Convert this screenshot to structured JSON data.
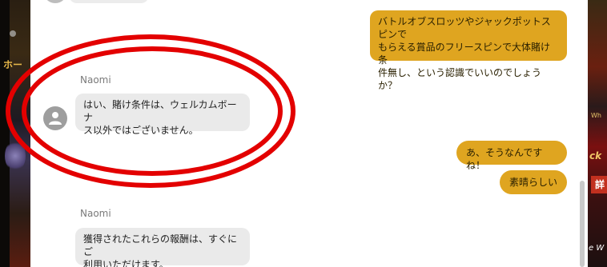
{
  "chat": {
    "messages": [
      {
        "direction": "outgoing",
        "text": "バトルオブスロッツやジャックポットスピンでもらえる賞品のフリースピンで大体賭け条件無し、という認識でいいのでしょうか？"
      },
      {
        "direction": "incoming",
        "sender": "Naomi",
        "text": "はい、賭け条件は、ウェルカムボーナス以外ではございません。"
      },
      {
        "direction": "outgoing",
        "text": "あ、そうなんですね！"
      },
      {
        "direction": "outgoing",
        "text": "素晴らしい"
      },
      {
        "direction": "incoming",
        "sender": "Naomi",
        "text": "獲得されたこれらの報酬は、すぐにご利用いただけます。"
      }
    ],
    "out_line1": "バトルオブスロッツやジャックポットスピンで",
    "out_line2": "もらえる賞品のフリースピンで大体賭け条",
    "out_line3": "件無し、という認識でいいのでしょうか？",
    "in1_line1": "はい、賭け条件は、ウェルカムボーナ",
    "in1_line2": "ス以外ではございません。",
    "in2_line1": "獲得されたこれらの報酬は、すぐにご",
    "in2_line2": "利用いただけます。"
  },
  "background": {
    "left_fragment": "ホー",
    "right_fragment_top": "Wh",
    "right_fragment_mid": "ck",
    "right_badge": "詳",
    "right_fragment_bottom": "e W"
  },
  "colors": {
    "outgoing_bubble": "#dfa520",
    "incoming_bubble": "#eaeaea",
    "annotation_ring": "#e30000",
    "avatar": "#9e9e9e"
  },
  "icons": {
    "avatar": "user-icon"
  }
}
